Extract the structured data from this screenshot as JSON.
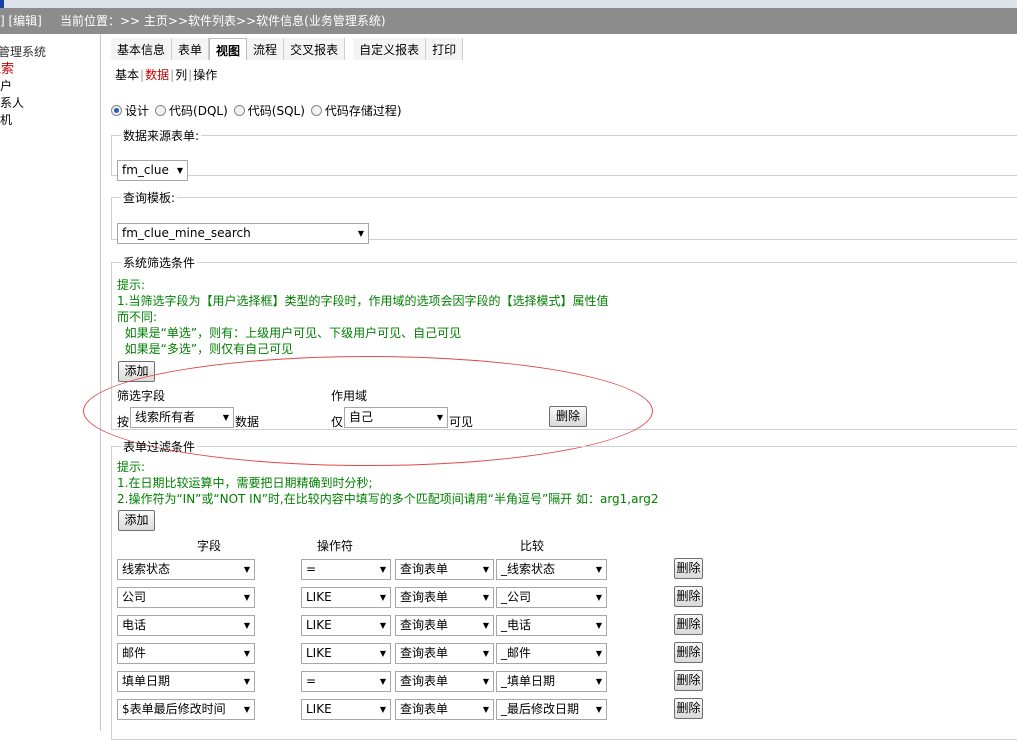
{
  "header": {
    "edit_label": "]  [编辑]",
    "location": "当前位置：>> 主页>>软件列表>>软件信息(业务管理系统)"
  },
  "left_nav": {
    "items": [
      "管理系统",
      "线索",
      "客户",
      "联系人",
      "商机"
    ]
  },
  "tabs": [
    "基本信息",
    "表单",
    "视图",
    "流程",
    "交叉报表",
    "自定义报表",
    "打印"
  ],
  "active_tab": "视图",
  "subnav": {
    "items": [
      "基本",
      "数据",
      "列",
      "操作"
    ],
    "separator": "|"
  },
  "mode": {
    "options": [
      "设计",
      "代码(DQL)",
      "代码(SQL)",
      "代码存储过程)"
    ],
    "selected": "设计"
  },
  "datasource": {
    "legend": "数据来源表单:",
    "value": "fm_clue"
  },
  "query_template": {
    "legend": "查询模板:",
    "value": "fm_clue_mine_search"
  },
  "system_filter": {
    "legend": "系统筛选条件",
    "hints": [
      "提示:",
      "1.当筛选字段为【用户选择框】类型的字段时，作用域的选项会因字段的【选择模式】属性值",
      "而不同:",
      "  如果是“单选”，则有：上级用户可见、下级用户可见、自己可见",
      "  如果是“多选”，则仅有自己可见"
    ],
    "add_label": "添加",
    "field_header": "筛选字段",
    "scope_header": "作用域",
    "by_label": "按",
    "field_value": "线索所有者",
    "data_label": "数据",
    "only_label": "仅",
    "scope_value": "自己",
    "visible_label": "可见",
    "delete_label": "删除"
  },
  "form_filter": {
    "legend": "表单过滤条件",
    "hints": [
      "提示:",
      "1.在日期比较运算中，需要把日期精确到时分秒;",
      "2.操作符为“IN”或“NOT IN”时,在比较内容中填写的多个匹配项间请用“半角逗号”隔开  如：arg1,arg2"
    ],
    "add_label": "添加",
    "columns": [
      "字段",
      "操作符",
      "比较"
    ],
    "delete_label": "删除",
    "rows": [
      {
        "field": "线索状态",
        "operator": "=",
        "source": "查询表单",
        "compare": "_线索状态"
      },
      {
        "field": "公司",
        "operator": "LIKE",
        "source": "查询表单",
        "compare": "_公司"
      },
      {
        "field": "电话",
        "operator": "LIKE",
        "source": "查询表单",
        "compare": "_电话"
      },
      {
        "field": "邮件",
        "operator": "LIKE",
        "source": "查询表单",
        "compare": "_邮件"
      },
      {
        "field": "填单日期",
        "operator": "=",
        "source": "查询表单",
        "compare": "_填单日期"
      },
      {
        "field": "$表单最后修改时间",
        "operator": "LIKE",
        "source": "查询表单",
        "compare": "_最后修改日期"
      }
    ]
  },
  "colors": {
    "highlight": "#cc0000",
    "hint": "#008000",
    "annotation": "#e04a4a",
    "titlebar": "#8c8c8c"
  }
}
